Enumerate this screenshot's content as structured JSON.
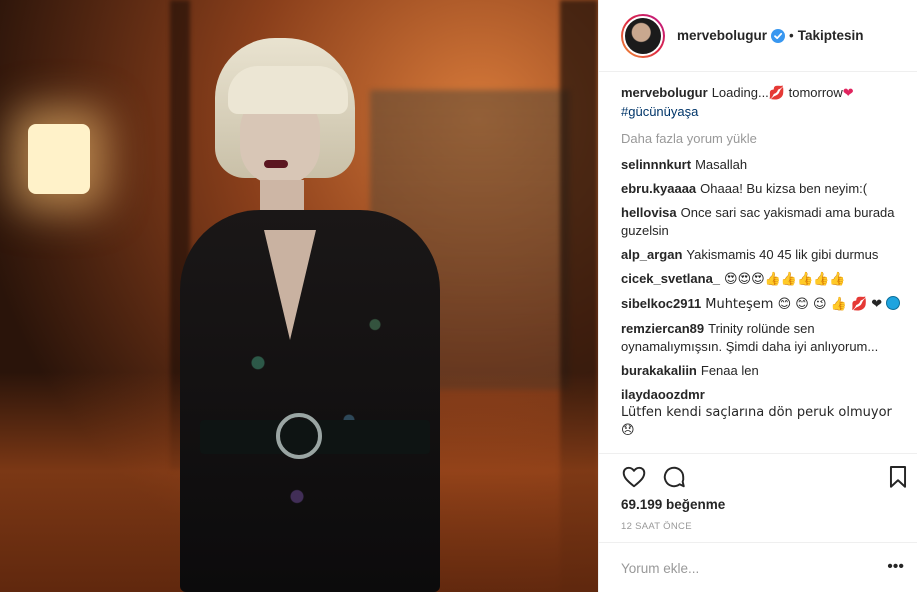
{
  "post": {
    "username": "mervebolugur",
    "follow_separator": "•",
    "follow_status": "Takiptesin",
    "caption": {
      "username": "mervebolugur",
      "text_before": "Loading...",
      "text_after": " tomorrow",
      "hashtag": "#gücünüyaşa"
    },
    "load_more": "Daha fazla yorum yükle",
    "comments": [
      {
        "user": "selinnnkurt",
        "text": "Masallah"
      },
      {
        "user": "ebru.kyaaaa",
        "text": "Ohaaa! Bu kizsa ben neyim:("
      },
      {
        "user": "hellovisa",
        "text": "Once sari sac yakismadi ama burada guzelsin"
      },
      {
        "user": "alp_argan",
        "text": "Yakismamis 40 45 lik gibi durmus"
      },
      {
        "user": "cicek_svetlana_",
        "text": "😍😍😍👍👍👍👍👍"
      },
      {
        "user": "sibelkoc2911",
        "text": "Muhteşem 😊 😊 😉 👍 💋 ❤"
      },
      {
        "user": "remziercan89",
        "text": "Trinity rolünde sen oynamalıymışsın. Şimdi daha iyi anlıyorum..."
      },
      {
        "user": "burakakaliin",
        "text": "Fenaa len"
      },
      {
        "user": "ilaydaoozdmr",
        "text": "Lütfen kendi saçlarına dön peruk olmuyor 😞"
      }
    ],
    "likes": "69.199 beğenme",
    "timestamp": "12 SAAT ÖNCE",
    "comment_placeholder": "Yorum ekle...",
    "more_options": "•••"
  },
  "icons": {
    "verified": "verified-badge-icon",
    "like": "heart-icon",
    "comment": "comment-bubble-icon",
    "save": "bookmark-icon",
    "lips": "kiss-lips-icon",
    "heart_red": "heart-icon"
  },
  "colors": {
    "text": "#262626",
    "muted": "#999999",
    "hashtag": "#003569",
    "verified": "#3897f0",
    "border": "#efefef"
  }
}
